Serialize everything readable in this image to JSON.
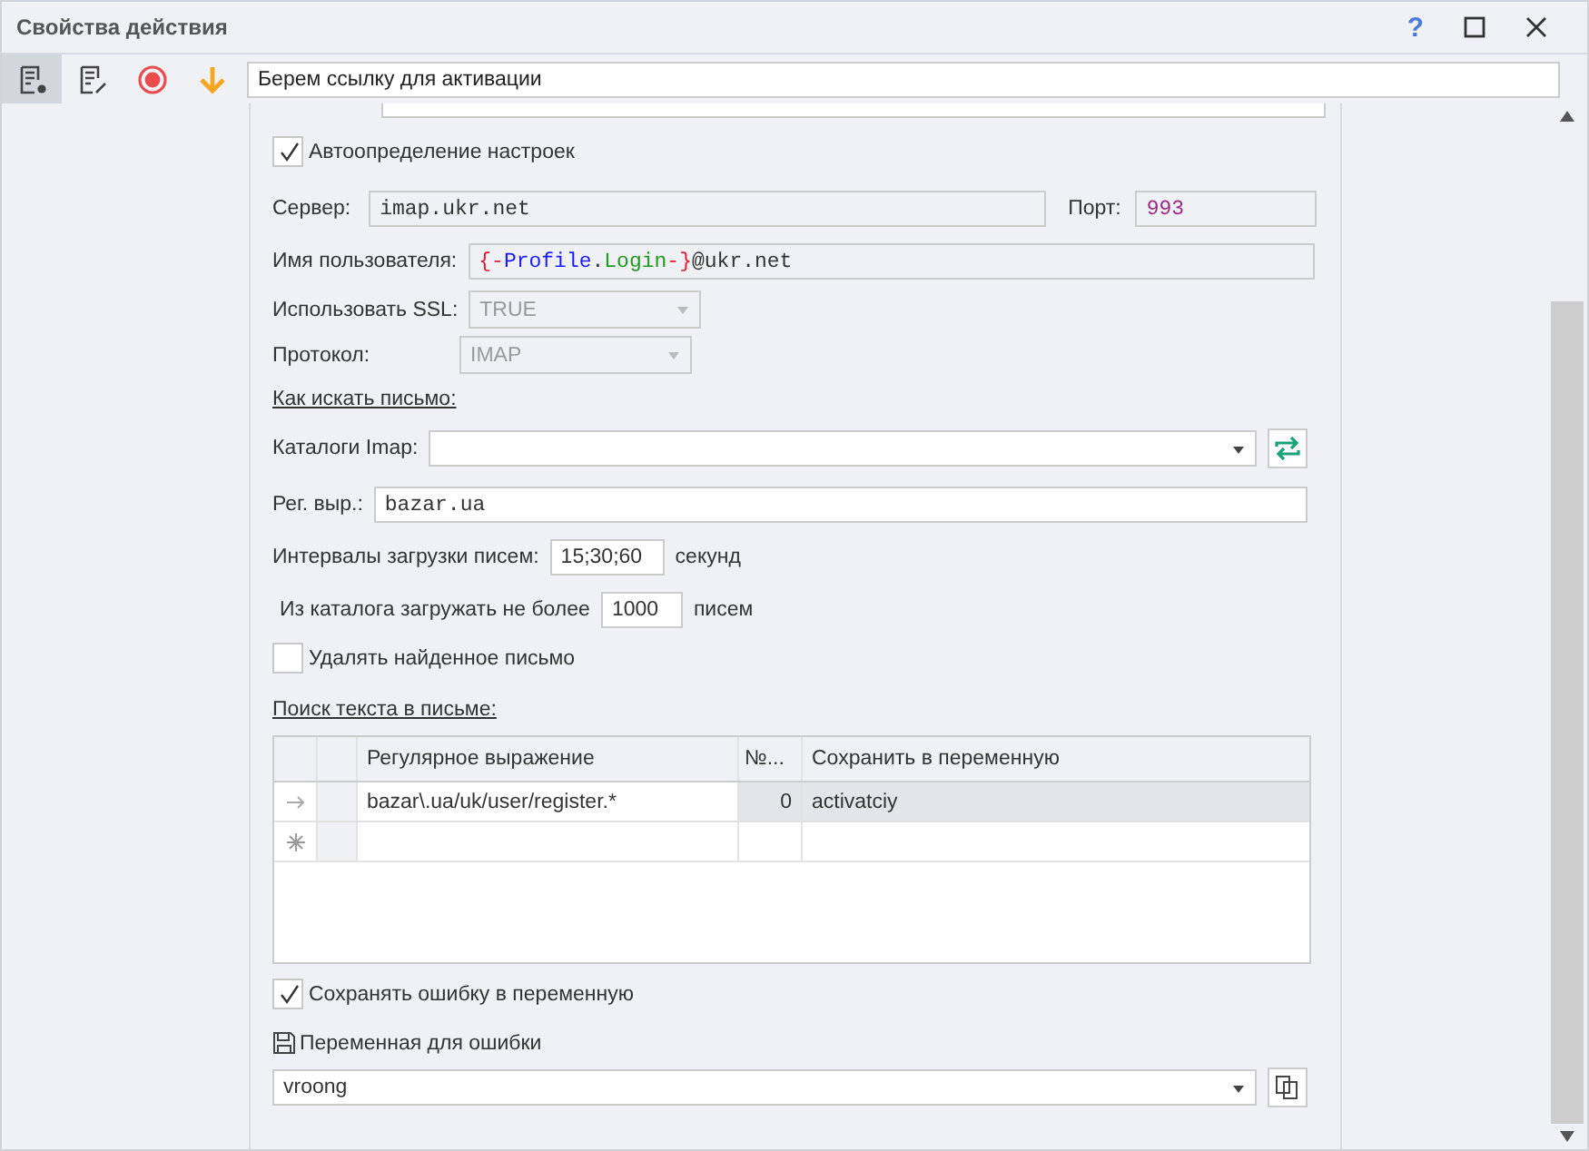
{
  "window": {
    "title": "Свойства действия",
    "help": "?"
  },
  "toolbar": {
    "action_name": "Берем ссылку для активации"
  },
  "auto_settings": {
    "label": "Автоопределение настроек",
    "checked": true
  },
  "server": {
    "label": "Сервер:",
    "value": "imap.ukr.net"
  },
  "port": {
    "label": "Порт:",
    "value": "993"
  },
  "username": {
    "label": "Имя пользователя:",
    "segments": [
      {
        "text": "{-",
        "color": "#e8172c"
      },
      {
        "text": "Profile",
        "color": "#1a1aff"
      },
      {
        "text": ".",
        "color": "#333333"
      },
      {
        "text": "Login",
        "color": "#1f9a1f"
      },
      {
        "text": "-}",
        "color": "#e8172c"
      },
      {
        "text": "@ukr.net",
        "color": "#333333"
      }
    ]
  },
  "ssl": {
    "label": "Использовать SSL:",
    "value": "TRUE",
    "disabled": true
  },
  "protocol": {
    "label": "Протокол:",
    "value": "IMAP",
    "disabled": true
  },
  "search_heading": "Как искать письмо:",
  "catalogs": {
    "label": "Каталоги Imap:"
  },
  "regex": {
    "label": "Рег. выр.:",
    "value": "bazar.ua"
  },
  "intervals": {
    "label": "Интервалы загрузки писем:",
    "value": "15;30;60",
    "unit": "секунд"
  },
  "limit": {
    "label": "Из каталога загружать не более",
    "value": "1000",
    "unit": "писем"
  },
  "delete_found": {
    "label": "Удалять найденное письмо",
    "checked": false
  },
  "text_search_heading": "Поиск текста в письме:",
  "table": {
    "columns": [
      "Регулярное выражение",
      "№...",
      "Сохранить в переменную"
    ],
    "rows": [
      {
        "cells": [
          "bazar\\.ua/uk/user/register.*",
          "0",
          "activatciy"
        ],
        "selected": true
      }
    ]
  },
  "save_error": {
    "label": "Сохранять ошибку в переменную",
    "checked": true
  },
  "error_variable": {
    "label": "Переменная для ошибки",
    "value": "vroong"
  }
}
